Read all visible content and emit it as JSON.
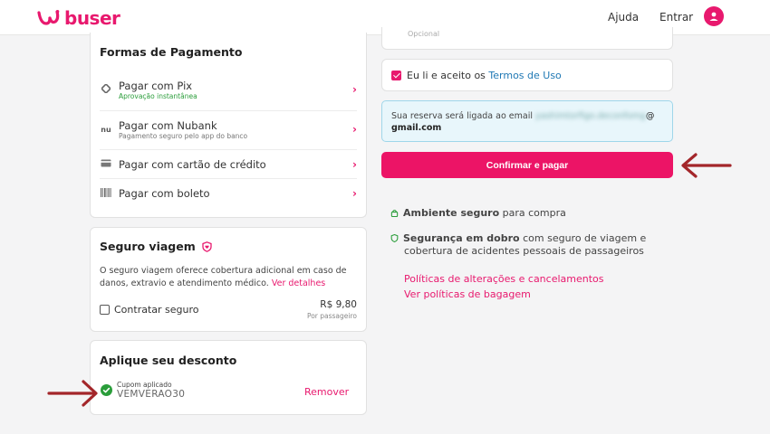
{
  "header": {
    "brand": "buser",
    "nav_help": "Ajuda",
    "nav_login": "Entrar"
  },
  "payment": {
    "title": "Formas de Pagamento",
    "methods": [
      {
        "label": "Pagar com Pix",
        "sub": "Aprovação instantânea",
        "icon": "pix-icon"
      },
      {
        "label": "Pagar com Nubank",
        "sub": "Pagamento seguro pelo app do banco",
        "icon": "nubank-icon"
      },
      {
        "label": "Pagar com cartão de crédito",
        "sub": "",
        "icon": "credit-card-icon"
      },
      {
        "label": "Pagar com boleto",
        "sub": "",
        "icon": "barcode-icon"
      }
    ]
  },
  "insurance": {
    "title": "Seguro viagem",
    "description": "O seguro viagem oferece cobertura adicional em caso de danos, extravio e atendimento médico.",
    "details_link": "Ver detalhes",
    "checkbox_label": "Contratar seguro",
    "price": "R$ 9,80",
    "price_unit": "Por passageiro"
  },
  "discount": {
    "title": "Aplique seu desconto",
    "applied_label": "Cupom aplicado",
    "code": "VEMVERAO30",
    "remove_label": "Remover"
  },
  "right": {
    "optional_text": "Opcional",
    "terms_prefix": "Eu li e aceito os",
    "terms_link": "Termos de Uso",
    "email_notice_prefix": "Sua reserva será ligada ao email",
    "email_blurred": "yashimtorfigo.deconfomg",
    "email_at": "@",
    "email_domain": "gmail.com",
    "confirm_button": "Confirmar e pagar",
    "secure_bold": "Ambiente seguro",
    "secure_rest": "para compra",
    "double_bold": "Segurança em dobro",
    "double_rest_1": "com seguro de viagem e",
    "double_rest_2": "cobertura de acidentes pessoais de passageiros",
    "policy_link_1": "Políticas de alterações e cancelamentos",
    "policy_link_2": "Ver políticas de bagagem"
  },
  "colors": {
    "brand": "#e8196e",
    "success": "#2a9d3a",
    "notice_bg": "#e8f6fb",
    "arrow": "#a3262a"
  }
}
